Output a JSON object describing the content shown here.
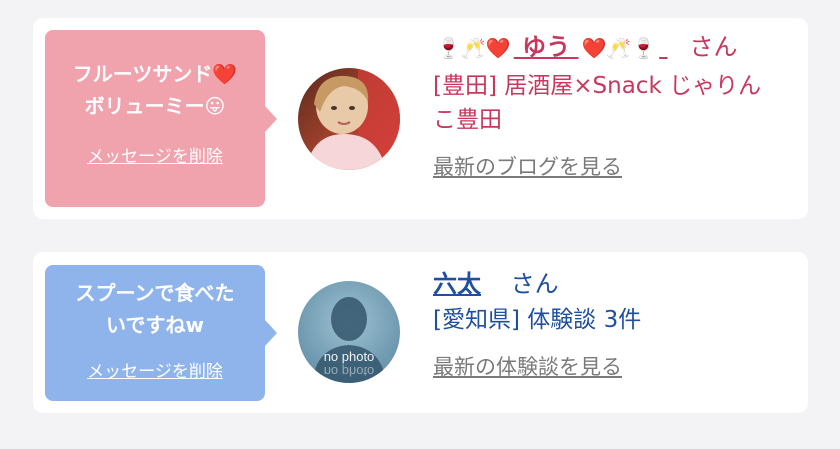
{
  "messages": [
    {
      "bubble_color": "#f0a2ad",
      "message_line1": "フルーツサンド❤️",
      "message_line2": "ボリューミー😛",
      "delete_label": "メッセージを削除",
      "name_prefix_emoji": "🍷🥂❤️",
      "name": "ゆう",
      "name_suffix_emoji": "❤️🥂🍷",
      "honorific": "さん",
      "shop_line1": "[豊田] 居酒屋×Snack じゃりん",
      "shop_line2": "こ豊田",
      "more_label": "最新のブログを見る"
    },
    {
      "bubble_color": "#8fb4ec",
      "message_line1": "スプーンで食べた",
      "message_line2": "いですねw",
      "delete_label": "メッセージを削除",
      "avatar_text": "no photo",
      "name": "六太",
      "honorific": "さん",
      "shop_line1": "[愛知県] 体験談 3件",
      "more_label": "最新の体験談を見る"
    }
  ]
}
